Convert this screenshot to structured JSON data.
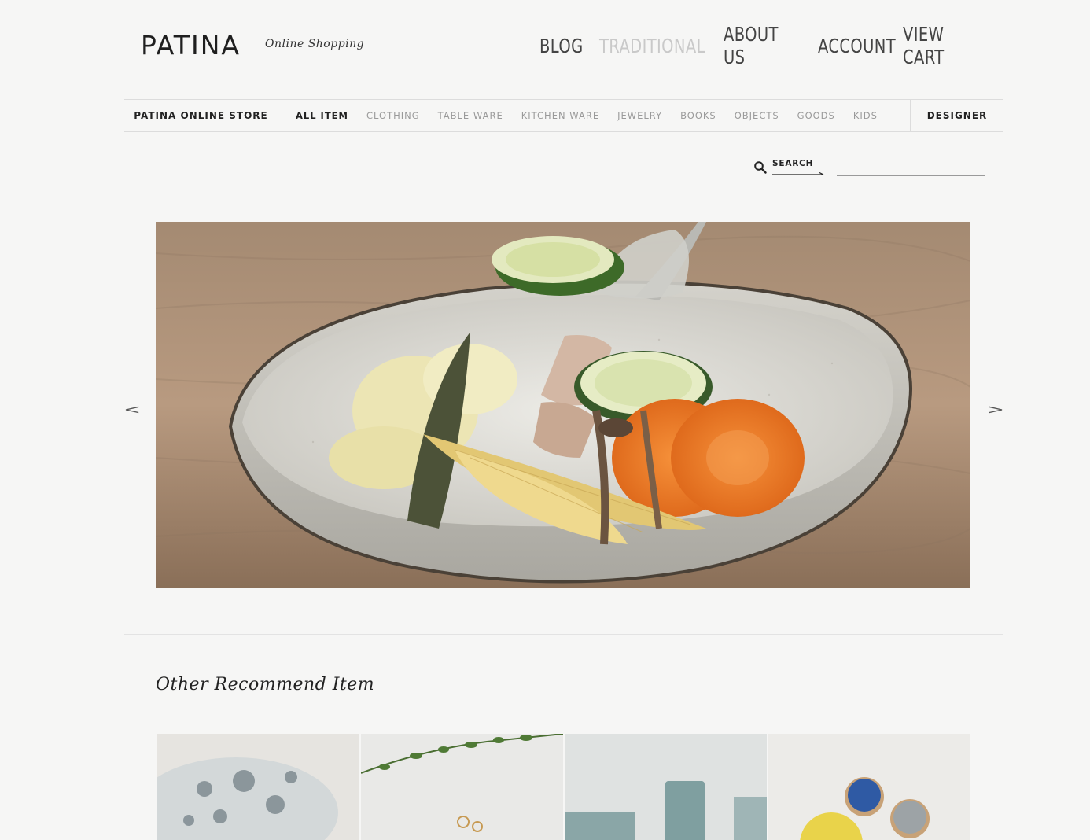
{
  "header": {
    "logo": "PATINA",
    "logo_subtitle": "Online Shopping",
    "nav": [
      {
        "label": "BLOG",
        "active": false
      },
      {
        "label": "TRADITIONAL",
        "active": true
      },
      {
        "label": "ABOUT US",
        "active": false
      },
      {
        "label": "ACCOUNT",
        "active": false
      },
      {
        "label": "VIEW CART",
        "active": false
      }
    ]
  },
  "category_bar": {
    "store_label": "PATINA ONLINE STORE",
    "categories": [
      {
        "label": "ALL ITEM",
        "active": true
      },
      {
        "label": "CLOTHING",
        "active": false
      },
      {
        "label": "TABLE WARE",
        "active": false
      },
      {
        "label": "KITCHEN WARE",
        "active": false
      },
      {
        "label": "JEWELRY",
        "active": false
      },
      {
        "label": "BOOKS",
        "active": false
      },
      {
        "label": "OBJECTS",
        "active": false
      },
      {
        "label": "GOODS",
        "active": false
      },
      {
        "label": "KIDS",
        "active": false
      }
    ],
    "designer_label": "DESIGNER"
  },
  "search": {
    "label": "SEARCH",
    "value": "",
    "placeholder": ""
  },
  "slider": {
    "prev": "<",
    "next": ">"
  },
  "recommend": {
    "title": "Other Recommend Item"
  },
  "colors": {
    "background": "#f6f6f5",
    "text": "#222222",
    "inactive_nav": "#c9c9c9",
    "category_muted": "#9a9a9a"
  },
  "icons": {
    "search": "search-icon"
  }
}
